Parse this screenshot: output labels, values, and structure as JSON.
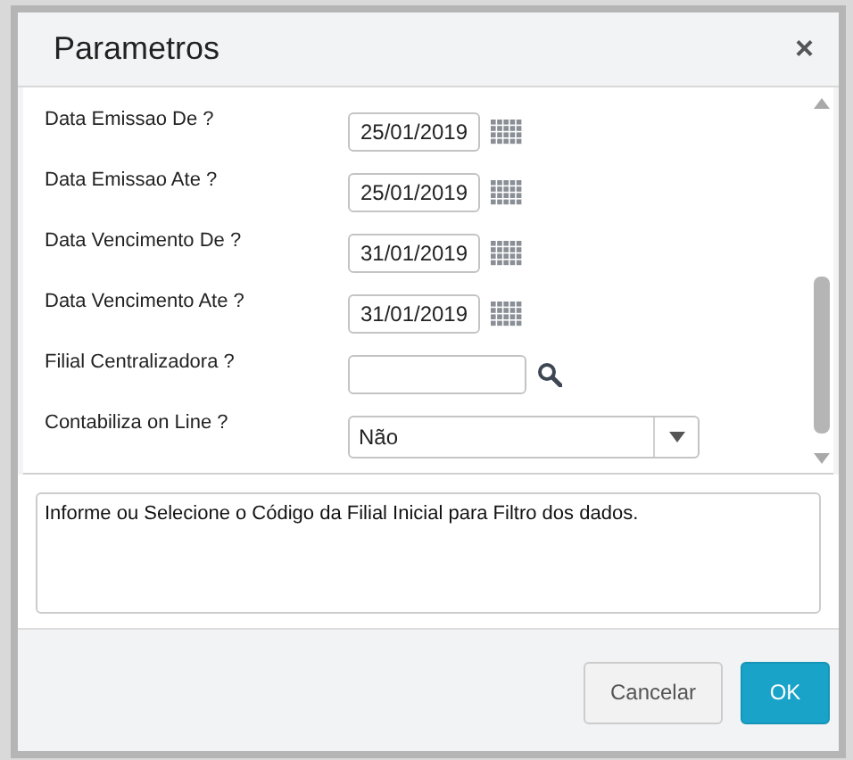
{
  "dialog": {
    "title": "Parametros",
    "close": "×"
  },
  "fields": [
    {
      "kind": "date",
      "label": "Data Emissao De ?",
      "value": "25/01/2019"
    },
    {
      "kind": "date",
      "label": "Data Emissao Ate ?",
      "value": "25/01/2019"
    },
    {
      "kind": "date",
      "label": "Data Vencimento De ?",
      "value": "31/01/2019"
    },
    {
      "kind": "date",
      "label": "Data Vencimento Ate ?",
      "value": "31/01/2019"
    },
    {
      "kind": "lookup",
      "label": "Filial Centralizadora ?"
    },
    {
      "kind": "select",
      "label": "Contabiliza on Line ?",
      "value": "Não"
    }
  ],
  "help": "Informe ou Selecione o Código da Filial Inicial para Filtro dos dados.",
  "buttons": [
    {
      "label": "Cancelar",
      "kind": "secondary"
    },
    {
      "label": "OK",
      "kind": "primary"
    }
  ]
}
